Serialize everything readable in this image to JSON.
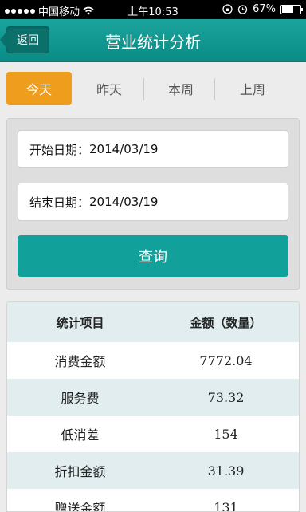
{
  "status_bar": {
    "carrier": "中国移动",
    "time": "上午10:53",
    "battery": "67%"
  },
  "nav": {
    "back_label": "返回",
    "title": "营业统计分析"
  },
  "tabs": [
    {
      "label": "今天"
    },
    {
      "label": "昨天"
    },
    {
      "label": "本周"
    },
    {
      "label": "上周"
    }
  ],
  "query": {
    "start_label": "开始日期：",
    "start_value": "2014/03/19",
    "end_label": "结束日期：",
    "end_value": "2014/03/19",
    "button_label": "查询"
  },
  "table": {
    "headers": [
      "统计项目",
      "金额（数量）"
    ],
    "rows": [
      {
        "item": "消费金额",
        "value": "7772.04"
      },
      {
        "item": "服务费",
        "value": "73.32"
      },
      {
        "item": "低消差",
        "value": "154"
      },
      {
        "item": "折扣金额",
        "value": "31.39"
      },
      {
        "item": "赠送金额",
        "value": "131"
      }
    ]
  }
}
